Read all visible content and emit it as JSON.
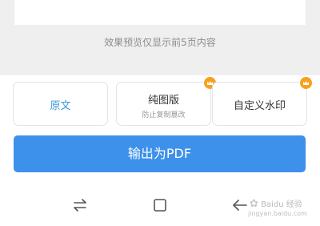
{
  "preview": {
    "note": "效果预览仅显示前5页内容"
  },
  "options": [
    {
      "label": "原文",
      "selected": true
    },
    {
      "label": "纯图版",
      "sublabel": "防止复制篡改",
      "vip": true
    },
    {
      "label": "自定义水印",
      "vip": true
    }
  ],
  "export": {
    "label": "输出为PDF"
  },
  "navbar": {
    "icons": [
      "switch-arrows-icon",
      "home-square-icon",
      "back-arrow-icon"
    ]
  },
  "watermark": {
    "text": "Baidu 经验",
    "sub": "jingyan.baidu.com"
  },
  "colors": {
    "accent": "#3d91ea",
    "selected_text": "#3a9bd9",
    "vip_badge": "#f6a11c",
    "preview_bg": "#efefef"
  }
}
